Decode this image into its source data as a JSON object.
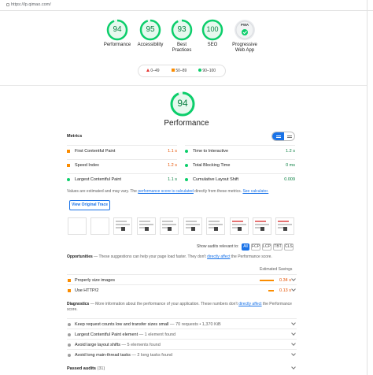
{
  "browser": {
    "url": "https://lp.qimao.com/"
  },
  "categories": [
    {
      "score": "94",
      "label": "Performance"
    },
    {
      "score": "95",
      "label": "Accessibility"
    },
    {
      "score": "93",
      "label": "Best Practices"
    },
    {
      "score": "100",
      "label": "SEO"
    },
    {
      "pwa_badge": "PWA",
      "label": "Progressive Web App"
    }
  ],
  "legend": {
    "red": "0–49",
    "orange": "50–89",
    "green": "90–100"
  },
  "performance": {
    "score": "94",
    "title": "Performance"
  },
  "metrics": {
    "heading": "Metrics",
    "left": [
      {
        "name": "First Contentful Paint",
        "value": "1.1 s",
        "status": "orange"
      },
      {
        "name": "Speed Index",
        "value": "1.2 s",
        "status": "orange"
      },
      {
        "name": "Largest Contentful Paint",
        "value": "1.1 s",
        "status": "green"
      }
    ],
    "right": [
      {
        "name": "Time to Interactive",
        "value": "1.2 s",
        "status": "green"
      },
      {
        "name": "Total Blocking Time",
        "value": "0 ms",
        "status": "green"
      },
      {
        "name": "Cumulative Layout Shift",
        "value": "0.009",
        "status": "green"
      }
    ]
  },
  "note": {
    "prefix": "Values are estimated and may vary. The ",
    "link1": "performance score is calculated",
    "middle": " directly from these metrics. ",
    "link2": "See calculator."
  },
  "trace_button": "View Original Trace",
  "audit_filter": {
    "label": "Show audits relevant to:",
    "chips": [
      "All",
      "FCP",
      "LCP",
      "TBT",
      "CLS"
    ]
  },
  "opportunities": {
    "title": "Opportunities",
    "desc_prefix": " — These suggestions can help your page load faster. They don't ",
    "desc_link": "directly affect",
    "desc_suffix": " the Performance score.",
    "col_header": "Estimated Savings",
    "items": [
      {
        "name": "Properly size images",
        "value": "0.34 s"
      },
      {
        "name": "Use HTTP/2",
        "value": "0.13 s"
      }
    ]
  },
  "diagnostics": {
    "title": "Diagnostics",
    "desc_prefix": " — More information about the performance of your application. These numbers don't ",
    "desc_link": "directly affect",
    "desc_suffix": " the Performance score.",
    "items": [
      {
        "name": "Keep request counts low and transfer sizes small",
        "sub": " — 70 requests • 1,370 KiB"
      },
      {
        "name": "Largest Contentful Paint element",
        "sub": " — 1 element found"
      },
      {
        "name": "Avoid large layout shifts",
        "sub": " — 5 elements found"
      },
      {
        "name": "Avoid long main-thread tasks",
        "sub": " — 2 long tasks found"
      }
    ]
  },
  "passed": {
    "label": "Passed audits",
    "count": "(31)"
  },
  "colors": {
    "green": "#0cce6b",
    "orange": "#fb8c00",
    "red": "#e53935",
    "link": "#1a73e8"
  }
}
